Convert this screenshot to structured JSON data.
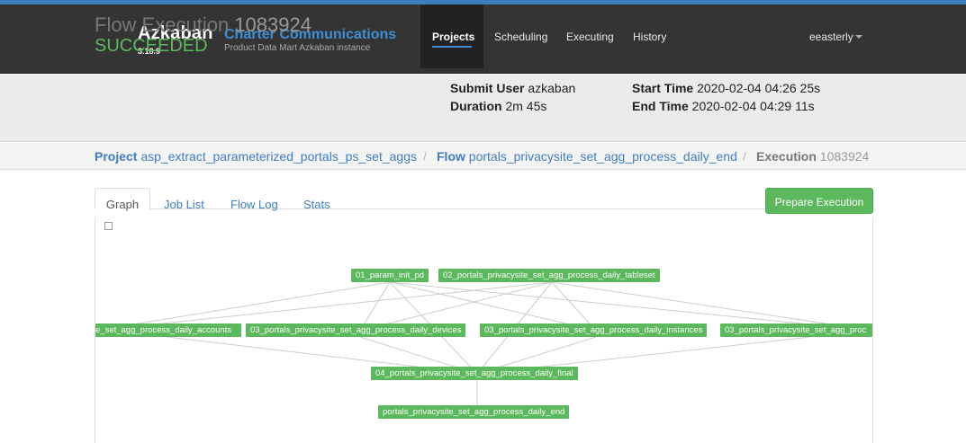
{
  "navbar": {
    "brand": "Azkaban",
    "version": "3.18.9",
    "org": "Charter Communications",
    "instance": "Product Data Mart Azkaban instance",
    "items": [
      {
        "label": "Projects",
        "active": true
      },
      {
        "label": "Scheduling",
        "active": false
      },
      {
        "label": "Executing",
        "active": false
      },
      {
        "label": "History",
        "active": false
      }
    ],
    "user": "eeasterly"
  },
  "header": {
    "title_label": "Flow Execution",
    "execution_id": "1083924",
    "status": "SUCCEEDED",
    "submit_user_label": "Submit User",
    "submit_user": "azkaban",
    "duration_label": "Duration",
    "duration": "2m 45s",
    "start_time_label": "Start Time",
    "start_time": "2020-02-04 04:26 25s",
    "end_time_label": "End Time",
    "end_time": "2020-02-04 04:29 11s"
  },
  "breadcrumb": {
    "project_label": "Project",
    "project": "asp_extract_parameterized_portals_ps_set_aggs",
    "flow_label": "Flow",
    "flow": "portals_privacysite_set_agg_process_daily_end",
    "execution_label": "Execution",
    "execution": "1083924",
    "separator": "/"
  },
  "tabs": [
    {
      "label": "Graph",
      "active": true
    },
    {
      "label": "Job List",
      "active": false
    },
    {
      "label": "Flow Log",
      "active": false
    },
    {
      "label": "Stats",
      "active": false
    }
  ],
  "actions": {
    "prepare_execution": "Prepare Execution"
  },
  "graph": {
    "nodes": {
      "param_init": "01_param_init_pd",
      "tableset": "02_portals_privacysite_set_agg_process_daily_tableset",
      "accounts": "e_set_agg_process_daily_accounts",
      "devices": "03_portals_privacysite_set_agg_process_daily_devices",
      "instances": "03_portals_privacysite_set_agg_process_daily_instances",
      "cut": "03_portals_privacysite_set_agg_proc",
      "final": "04_portals_privacysite_set_agg_process_daily_final",
      "end": "portals_privacysite_set_agg_process_daily_end"
    },
    "node_color": "#5cb85c",
    "edge_color": "#cccccc"
  },
  "colors": {
    "navbar_bg": "#343434",
    "accent": "#3e8ed6",
    "success": "#5cb85c"
  }
}
